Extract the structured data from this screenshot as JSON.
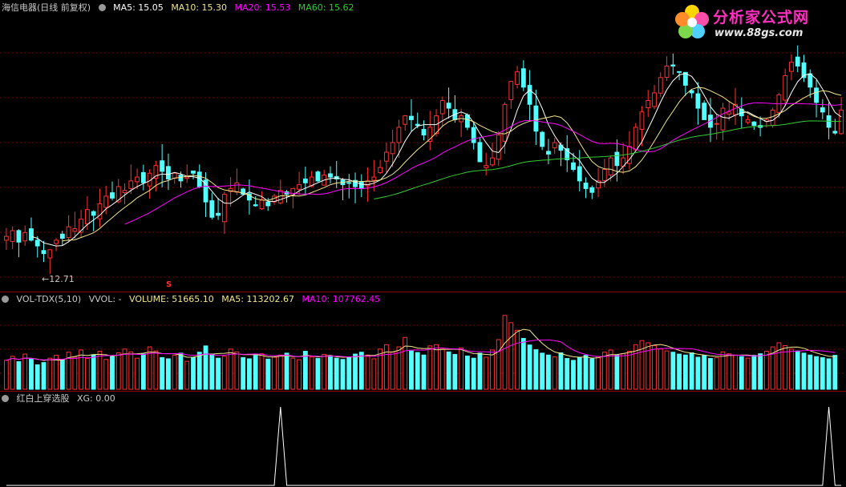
{
  "header": {
    "title": "海信电器(日线 前复权)",
    "ma": [
      {
        "label": "MA5: 15.05",
        "color": "#ffffff"
      },
      {
        "label": "MA10: 15.30",
        "color": "#f0e68c"
      },
      {
        "label": "MA20: 15.53",
        "color": "#ff00ff"
      },
      {
        "label": "MA60: 15.62",
        "color": "#33cc33"
      }
    ]
  },
  "vol_header": {
    "title": "VOL-TDX(5,10)",
    "vvol": "VVOL: -",
    "volume": "VOLUME: 51665.10",
    "ma5": "MA5: 113202.67",
    "ma10": "MA10: 107762.45"
  },
  "xg_header": {
    "title": "红白上穿选股",
    "xg": "XG: 0.00"
  },
  "low_label": "12.71",
  "s_marker": "S",
  "logo": {
    "title": "分析家公式网",
    "url": "www.88gs.com"
  },
  "colors": {
    "up": "#ff3030",
    "down": "#54ffff",
    "grid": "#7a0000",
    "ma5": "#ffffff",
    "ma10": "#f0e68c",
    "ma20": "#ff00ff",
    "ma60": "#33cc33"
  },
  "chart_data": [
    {
      "type": "candlestick",
      "title": "海信电器(日线 前复权)",
      "ylim": [
        12.0,
        19.2
      ],
      "min_label": 12.71,
      "close": [
        13.4,
        13.55,
        13.25,
        13.5,
        13.3,
        13.15,
        12.95,
        13.05,
        13.3,
        13.35,
        13.65,
        13.6,
        13.85,
        14.1,
        13.95,
        14.25,
        14.45,
        14.4,
        14.7,
        14.6,
        14.85,
        14.95,
        14.8,
        15.05,
        15.25,
        15.1,
        14.9,
        15.05,
        14.85,
        14.95,
        15.05,
        14.7,
        14.3,
        13.9,
        13.95,
        14.5,
        14.65,
        14.8,
        14.5,
        14.35,
        14.2,
        14.35,
        14.2,
        14.45,
        14.6,
        14.5,
        14.65,
        14.75,
        14.8,
        14.95,
        14.85,
        15.0,
        14.95,
        14.9,
        14.75,
        14.8,
        14.7,
        14.65,
        14.85,
        14.95,
        15.2,
        15.6,
        15.85,
        16.25,
        16.55,
        16.45,
        16.3,
        16.05,
        16.25,
        16.55,
        16.95,
        16.75,
        16.45,
        16.55,
        16.25,
        15.85,
        15.35,
        15.25,
        15.45,
        16.05,
        16.85,
        17.45,
        17.7,
        17.3,
        16.85,
        16.15,
        15.75,
        15.55,
        15.85,
        15.65,
        15.4,
        15.15,
        14.85,
        14.65,
        14.55,
        14.85,
        15.15,
        15.45,
        15.25,
        15.45,
        15.75,
        16.25,
        16.65,
        16.95,
        17.15,
        17.55,
        17.85,
        17.85,
        17.7,
        17.35,
        17.15,
        16.75,
        16.45,
        16.25,
        16.35,
        16.75,
        16.65,
        16.85,
        16.55,
        16.45,
        16.3,
        16.25,
        16.45,
        16.7,
        17.1,
        17.6,
        17.95,
        17.85,
        17.55,
        17.3,
        16.9,
        16.65,
        16.25,
        16.1,
        16.7
      ],
      "series": [
        {
          "name": "MA5",
          "value": 15.05
        },
        {
          "name": "MA10",
          "value": 15.3
        },
        {
          "name": "MA20",
          "value": 15.53
        },
        {
          "name": "MA60",
          "value": 15.62
        }
      ]
    },
    {
      "type": "bar",
      "title": "VOL-TDX(5,10)",
      "ylim": [
        0,
        260000
      ],
      "values": [
        92000,
        105000,
        88000,
        112000,
        96000,
        78000,
        85000,
        99000,
        108000,
        94000,
        118000,
        102000,
        125000,
        98000,
        110000,
        121000,
        95000,
        104000,
        116000,
        128000,
        119000,
        99000,
        112000,
        135000,
        122000,
        101000,
        97000,
        108000,
        115000,
        89000,
        102000,
        118000,
        138000,
        112000,
        99000,
        105000,
        128000,
        119000,
        101000,
        97000,
        108000,
        113000,
        96000,
        102000,
        109000,
        115000,
        99000,
        94000,
        121000,
        103000,
        98000,
        111000,
        107000,
        99000,
        95000,
        102000,
        112000,
        118000,
        109000,
        97000,
        128000,
        142000,
        118000,
        135000,
        165000,
        122000,
        117000,
        109000,
        138000,
        142000,
        128000,
        119000,
        111000,
        132000,
        106000,
        99000,
        115000,
        102000,
        125000,
        158000,
        235000,
        212000,
        188000,
        162000,
        141000,
        126000,
        115000,
        109000,
        103000,
        116000,
        98000,
        92000,
        101000,
        108000,
        97000,
        104000,
        118000,
        125000,
        109000,
        113000,
        121000,
        142000,
        155000,
        148000,
        139000,
        128000,
        122000,
        118000,
        112000,
        109000,
        116000,
        102000,
        107000,
        98000,
        101000,
        119000,
        113000,
        109000,
        104000,
        99000,
        108000,
        113000,
        121000,
        135000,
        148000,
        139000,
        128000,
        122000,
        115000,
        109000,
        104000,
        101000,
        97000,
        108000
      ],
      "series": [
        {
          "name": "VOLUME",
          "value": 51665.1
        },
        {
          "name": "MA5",
          "value": 113202.67
        },
        {
          "name": "MA10",
          "value": 107762.45
        }
      ]
    },
    {
      "type": "line",
      "title": "红白上穿选股",
      "x": [
        0,
        135
      ],
      "signals": [
        44,
        132
      ],
      "series": [
        {
          "name": "XG",
          "value": 0.0
        }
      ]
    }
  ]
}
